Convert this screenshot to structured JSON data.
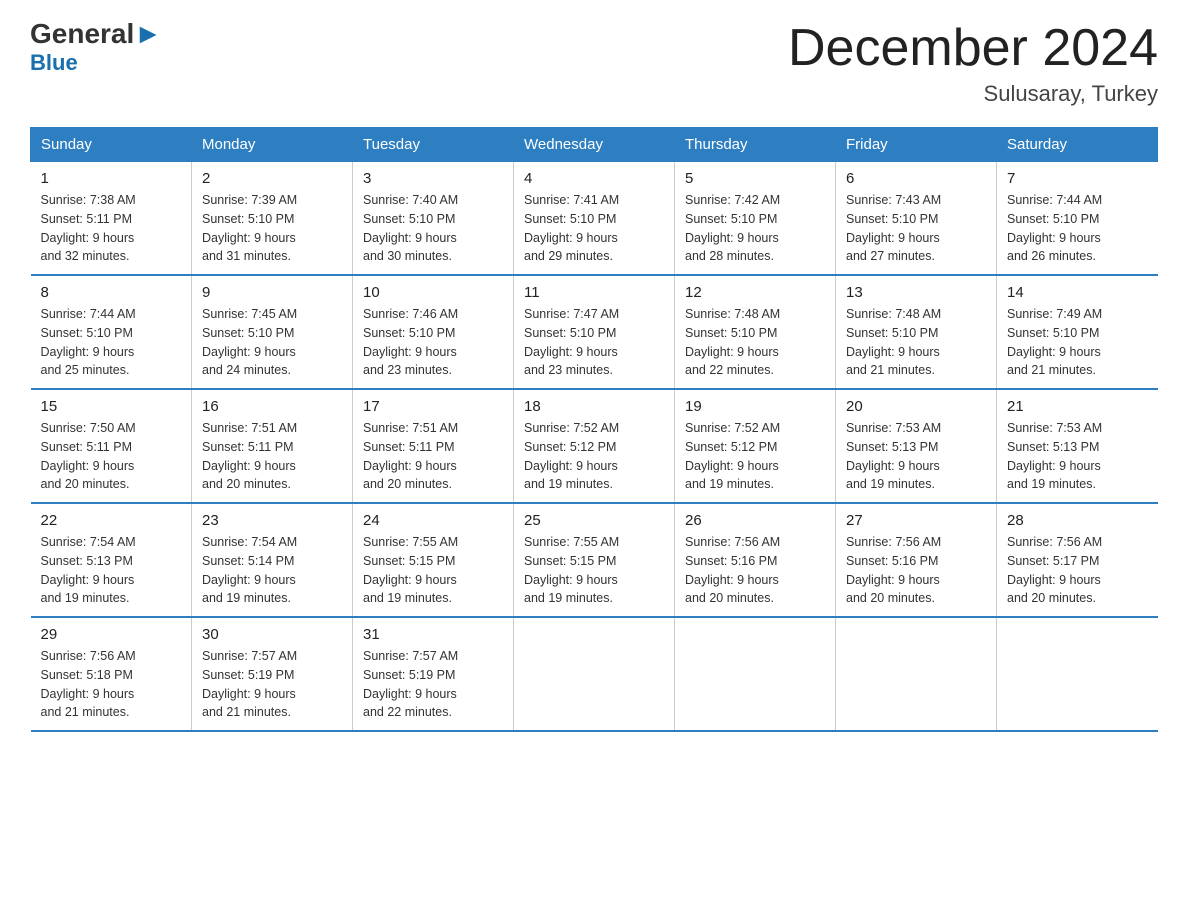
{
  "logo": {
    "general": "General",
    "triangle": "▶",
    "blue": "Blue"
  },
  "title": "December 2024",
  "subtitle": "Sulusaray, Turkey",
  "days_of_week": [
    "Sunday",
    "Monday",
    "Tuesday",
    "Wednesday",
    "Thursday",
    "Friday",
    "Saturday"
  ],
  "weeks": [
    [
      {
        "num": "1",
        "sunrise": "7:38 AM",
        "sunset": "5:11 PM",
        "daylight": "9 hours and 32 minutes."
      },
      {
        "num": "2",
        "sunrise": "7:39 AM",
        "sunset": "5:10 PM",
        "daylight": "9 hours and 31 minutes."
      },
      {
        "num": "3",
        "sunrise": "7:40 AM",
        "sunset": "5:10 PM",
        "daylight": "9 hours and 30 minutes."
      },
      {
        "num": "4",
        "sunrise": "7:41 AM",
        "sunset": "5:10 PM",
        "daylight": "9 hours and 29 minutes."
      },
      {
        "num": "5",
        "sunrise": "7:42 AM",
        "sunset": "5:10 PM",
        "daylight": "9 hours and 28 minutes."
      },
      {
        "num": "6",
        "sunrise": "7:43 AM",
        "sunset": "5:10 PM",
        "daylight": "9 hours and 27 minutes."
      },
      {
        "num": "7",
        "sunrise": "7:44 AM",
        "sunset": "5:10 PM",
        "daylight": "9 hours and 26 minutes."
      }
    ],
    [
      {
        "num": "8",
        "sunrise": "7:44 AM",
        "sunset": "5:10 PM",
        "daylight": "9 hours and 25 minutes."
      },
      {
        "num": "9",
        "sunrise": "7:45 AM",
        "sunset": "5:10 PM",
        "daylight": "9 hours and 24 minutes."
      },
      {
        "num": "10",
        "sunrise": "7:46 AM",
        "sunset": "5:10 PM",
        "daylight": "9 hours and 23 minutes."
      },
      {
        "num": "11",
        "sunrise": "7:47 AM",
        "sunset": "5:10 PM",
        "daylight": "9 hours and 23 minutes."
      },
      {
        "num": "12",
        "sunrise": "7:48 AM",
        "sunset": "5:10 PM",
        "daylight": "9 hours and 22 minutes."
      },
      {
        "num": "13",
        "sunrise": "7:48 AM",
        "sunset": "5:10 PM",
        "daylight": "9 hours and 21 minutes."
      },
      {
        "num": "14",
        "sunrise": "7:49 AM",
        "sunset": "5:10 PM",
        "daylight": "9 hours and 21 minutes."
      }
    ],
    [
      {
        "num": "15",
        "sunrise": "7:50 AM",
        "sunset": "5:11 PM",
        "daylight": "9 hours and 20 minutes."
      },
      {
        "num": "16",
        "sunrise": "7:51 AM",
        "sunset": "5:11 PM",
        "daylight": "9 hours and 20 minutes."
      },
      {
        "num": "17",
        "sunrise": "7:51 AM",
        "sunset": "5:11 PM",
        "daylight": "9 hours and 20 minutes."
      },
      {
        "num": "18",
        "sunrise": "7:52 AM",
        "sunset": "5:12 PM",
        "daylight": "9 hours and 19 minutes."
      },
      {
        "num": "19",
        "sunrise": "7:52 AM",
        "sunset": "5:12 PM",
        "daylight": "9 hours and 19 minutes."
      },
      {
        "num": "20",
        "sunrise": "7:53 AM",
        "sunset": "5:13 PM",
        "daylight": "9 hours and 19 minutes."
      },
      {
        "num": "21",
        "sunrise": "7:53 AM",
        "sunset": "5:13 PM",
        "daylight": "9 hours and 19 minutes."
      }
    ],
    [
      {
        "num": "22",
        "sunrise": "7:54 AM",
        "sunset": "5:13 PM",
        "daylight": "9 hours and 19 minutes."
      },
      {
        "num": "23",
        "sunrise": "7:54 AM",
        "sunset": "5:14 PM",
        "daylight": "9 hours and 19 minutes."
      },
      {
        "num": "24",
        "sunrise": "7:55 AM",
        "sunset": "5:15 PM",
        "daylight": "9 hours and 19 minutes."
      },
      {
        "num": "25",
        "sunrise": "7:55 AM",
        "sunset": "5:15 PM",
        "daylight": "9 hours and 19 minutes."
      },
      {
        "num": "26",
        "sunrise": "7:56 AM",
        "sunset": "5:16 PM",
        "daylight": "9 hours and 20 minutes."
      },
      {
        "num": "27",
        "sunrise": "7:56 AM",
        "sunset": "5:16 PM",
        "daylight": "9 hours and 20 minutes."
      },
      {
        "num": "28",
        "sunrise": "7:56 AM",
        "sunset": "5:17 PM",
        "daylight": "9 hours and 20 minutes."
      }
    ],
    [
      {
        "num": "29",
        "sunrise": "7:56 AM",
        "sunset": "5:18 PM",
        "daylight": "9 hours and 21 minutes."
      },
      {
        "num": "30",
        "sunrise": "7:57 AM",
        "sunset": "5:19 PM",
        "daylight": "9 hours and 21 minutes."
      },
      {
        "num": "31",
        "sunrise": "7:57 AM",
        "sunset": "5:19 PM",
        "daylight": "9 hours and 22 minutes."
      },
      null,
      null,
      null,
      null
    ]
  ],
  "labels": {
    "sunrise": "Sunrise:",
    "sunset": "Sunset:",
    "daylight": "Daylight:"
  }
}
